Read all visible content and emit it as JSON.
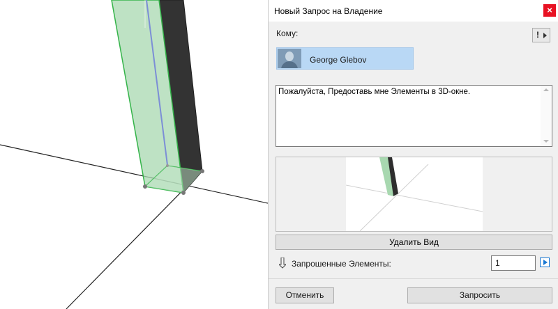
{
  "dialog": {
    "title": "Новый Запрос на Владение",
    "close_glyph": "×",
    "to_label": "Кому:",
    "alert_glyph": "!",
    "recipient": {
      "name": "George Glebov",
      "avatar_icon": "user-avatar"
    },
    "message": "Пожалуйста, Предоставь мне Элементы в 3D-окне.",
    "delete_view_label": "Удалить Вид",
    "requested_label": "Запрошенные Элементы:",
    "requested_count": "1",
    "cancel_label": "Отменить",
    "request_label": "Запросить"
  },
  "colors": {
    "close_red": "#e81123",
    "recipient_highlight": "#b9d8f5",
    "element_green": "#a8d8b0",
    "element_dark": "#333333",
    "axis_blue": "#1977d2"
  }
}
